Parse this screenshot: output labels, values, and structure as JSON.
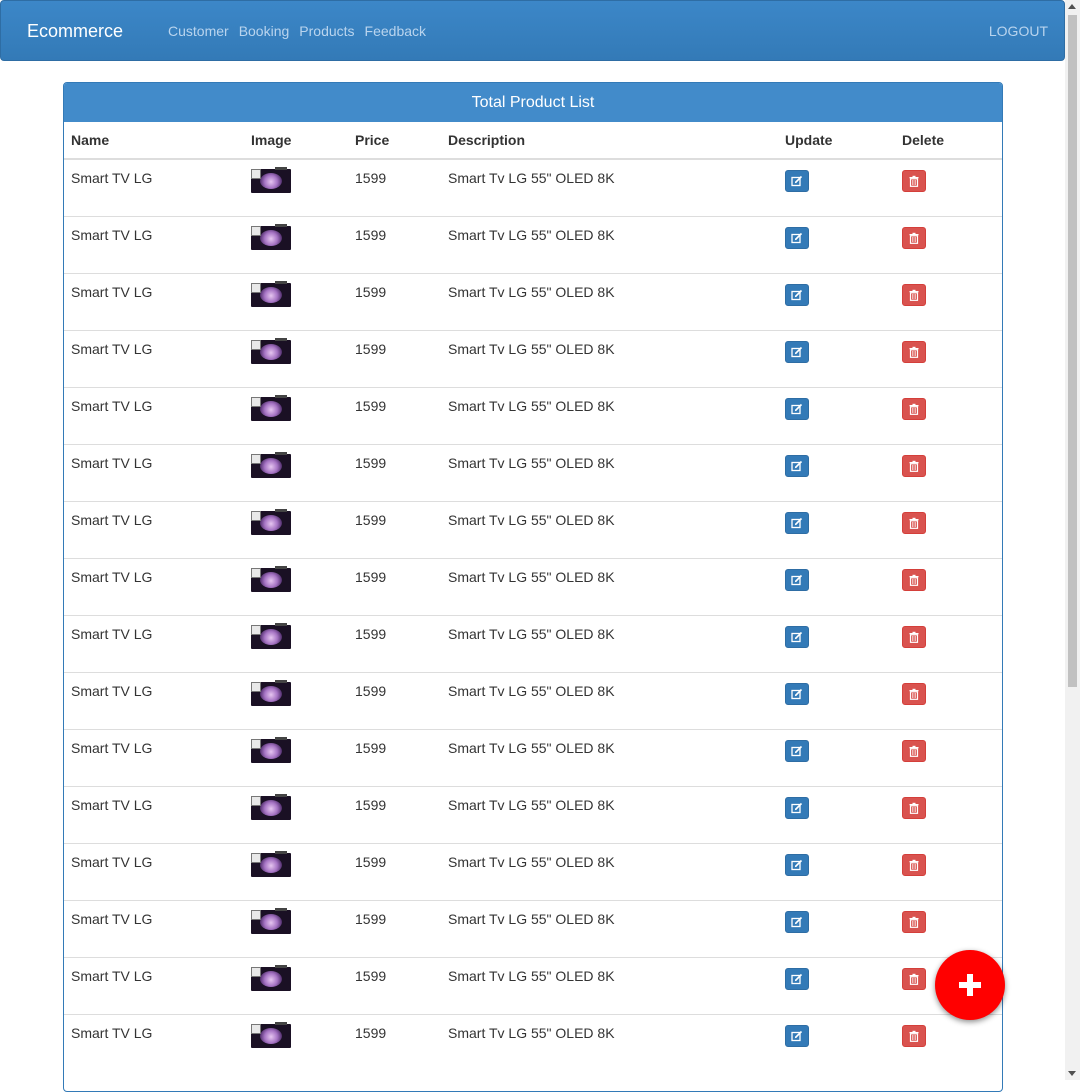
{
  "navbar": {
    "brand": "Ecommerce",
    "links": [
      "Customer",
      "Booking",
      "Products",
      "Feedback"
    ],
    "logout": "LOGOUT"
  },
  "panel": {
    "title": "Total Product List"
  },
  "table": {
    "headers": {
      "name": "Name",
      "image": "Image",
      "price": "Price",
      "description": "Description",
      "update": "Update",
      "delete": "Delete"
    },
    "rows": [
      {
        "name": "Smart TV LG",
        "price": "1599",
        "description": "Smart Tv LG 55\" OLED 8K"
      },
      {
        "name": "Smart TV LG",
        "price": "1599",
        "description": "Smart Tv LG 55\" OLED 8K"
      },
      {
        "name": "Smart TV LG",
        "price": "1599",
        "description": "Smart Tv LG 55\" OLED 8K"
      },
      {
        "name": "Smart TV LG",
        "price": "1599",
        "description": "Smart Tv LG 55\" OLED 8K"
      },
      {
        "name": "Smart TV LG",
        "price": "1599",
        "description": "Smart Tv LG 55\" OLED 8K"
      },
      {
        "name": "Smart TV LG",
        "price": "1599",
        "description": "Smart Tv LG 55\" OLED 8K"
      },
      {
        "name": "Smart TV LG",
        "price": "1599",
        "description": "Smart Tv LG 55\" OLED 8K"
      },
      {
        "name": "Smart TV LG",
        "price": "1599",
        "description": "Smart Tv LG 55\" OLED 8K"
      },
      {
        "name": "Smart TV LG",
        "price": "1599",
        "description": "Smart Tv LG 55\" OLED 8K"
      },
      {
        "name": "Smart TV LG",
        "price": "1599",
        "description": "Smart Tv LG 55\" OLED 8K"
      },
      {
        "name": "Smart TV LG",
        "price": "1599",
        "description": "Smart Tv LG 55\" OLED 8K"
      },
      {
        "name": "Smart TV LG",
        "price": "1599",
        "description": "Smart Tv LG 55\" OLED 8K"
      },
      {
        "name": "Smart TV LG",
        "price": "1599",
        "description": "Smart Tv LG 55\" OLED 8K"
      },
      {
        "name": "Smart TV LG",
        "price": "1599",
        "description": "Smart Tv LG 55\" OLED 8K"
      },
      {
        "name": "Smart TV LG",
        "price": "1599",
        "description": "Smart Tv LG 55\" OLED 8K"
      },
      {
        "name": "Smart TV LG",
        "price": "1599",
        "description": "Smart Tv LG 55\" OLED 8K"
      }
    ],
    "row_icons": {
      "image": "tv-thumbnail",
      "update": "edit-icon",
      "delete": "trash-icon"
    }
  },
  "fab": {
    "icon": "plus-icon"
  },
  "colors": {
    "navbar": "#337ab7",
    "panel_heading": "#428bca",
    "edit_button": "#337ab7",
    "delete_button": "#d9534f",
    "fab": "#ff0000"
  }
}
